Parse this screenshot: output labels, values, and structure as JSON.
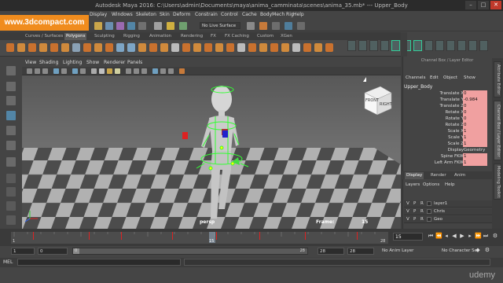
{
  "window": {
    "title": "Autodesk Maya 2016: C:\\Users\\admin\\Documents\\maya\\anima_camminata\\scenes\\anima_35.mb* --- Upper_Body"
  },
  "watermark": "www.3dcompact.com",
  "menubar": [
    "Display",
    "Windows",
    "Skeleton",
    "Skin",
    "Deform",
    "Constrain",
    "Control",
    "Cache",
    "BodyMech Rig",
    "Help"
  ],
  "live_surface": "No Live Surface",
  "shelf_tabs": [
    "Curves / Surfaces",
    "Polygons",
    "Sculpting",
    "Rigging",
    "Animation",
    "Rendering",
    "FX",
    "FX Caching",
    "Custom",
    "XGen"
  ],
  "active_shelf": "Polygons",
  "viewport": {
    "menu": [
      "View",
      "Shading",
      "Lighting",
      "Show",
      "Renderer",
      "Panels"
    ],
    "camera_label": "persp",
    "frame_label": "Frame:",
    "frame_value": "15",
    "viewcube_labels": [
      "FRONT",
      "RIGHT"
    ]
  },
  "channel_box": {
    "header": "Channel Box / Layer Editor",
    "menu": [
      "Channels",
      "Edit",
      "Object",
      "Show"
    ],
    "object": "Upper_Body",
    "attributes": [
      {
        "name": "Translate X",
        "value": "0"
      },
      {
        "name": "Translate Y",
        "value": "-0.984"
      },
      {
        "name": "Translate Z",
        "value": "0"
      },
      {
        "name": "Rotate X",
        "value": "0"
      },
      {
        "name": "Rotate Y",
        "value": "0"
      },
      {
        "name": "Rotate Z",
        "value": "0"
      },
      {
        "name": "Scale X",
        "value": "1"
      },
      {
        "name": "Scale Y",
        "value": "1"
      },
      {
        "name": "Scale Z",
        "value": "1"
      },
      {
        "name": "Display",
        "value": "Geometry"
      },
      {
        "name": "Spine FKIK",
        "value": "1"
      },
      {
        "name": "Left Arm FKIK",
        "value": "1"
      }
    ],
    "side_tabs": [
      "Attribute Editor",
      "Channel Box / Layer Editor",
      "Modeling Toolkit"
    ]
  },
  "layer_editor": {
    "tabs": [
      "Display",
      "Render",
      "Anim"
    ],
    "active_tab": "Display",
    "menu": [
      "Layers",
      "Options",
      "Help"
    ],
    "layers": [
      {
        "v": "V",
        "p": "P",
        "r": "R",
        "name": "layer1"
      },
      {
        "v": "V",
        "p": "P",
        "r": "R",
        "name": "Chris"
      },
      {
        "v": "V",
        "p": "P",
        "r": "R",
        "name": "Geo"
      }
    ]
  },
  "timeline": {
    "ticks": [
      "1",
      "15",
      "28"
    ],
    "current_frame": "15",
    "range_start": "1",
    "range_inner_start": "0",
    "range_slider_start": "0",
    "range_end": "28",
    "range_inner_end": "28",
    "range_outer_end": "28",
    "anim_layer": "No Anim Layer",
    "char_set": "No Character Set"
  },
  "command_line": {
    "label": "MEL"
  },
  "brand": "udemy",
  "colors": {
    "accent": "#f08c1e",
    "selection": "#5285a6",
    "keyed": "#f0a0a0",
    "rig_green": "#3f3"
  }
}
